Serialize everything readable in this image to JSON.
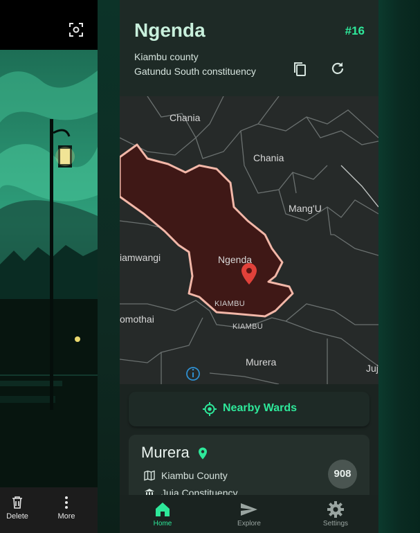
{
  "left_panel": {
    "actions": [
      {
        "label": "Delete",
        "icon": "trash-icon"
      },
      {
        "label": "More",
        "icon": "more-vertical-icon"
      }
    ]
  },
  "header": {
    "title": "Ngenda",
    "ward_number": "#16",
    "county": "Kiambu county",
    "constituency": "Gatundu South constituency"
  },
  "map": {
    "labels": [
      {
        "text": "Chania",
        "kind": "place"
      },
      {
        "text": "Chania",
        "kind": "place"
      },
      {
        "text": "Mang'U",
        "kind": "place"
      },
      {
        "text": "iamwangi",
        "kind": "place"
      },
      {
        "text": "Ngenda",
        "kind": "place"
      },
      {
        "text": "KIAMBU",
        "kind": "county"
      },
      {
        "text": "KIAMBU",
        "kind": "county"
      },
      {
        "text": "omothai",
        "kind": "place"
      },
      {
        "text": "Murera",
        "kind": "place"
      },
      {
        "text": "Juj",
        "kind": "place"
      }
    ]
  },
  "nearby": {
    "label": "Nearby Wards"
  },
  "ward_card": {
    "name": "Murera",
    "county": "Kiambu County",
    "constituency": "Juja Constituency",
    "badge": "908"
  },
  "nav": [
    {
      "label": "Home",
      "icon": "home-icon"
    },
    {
      "label": "Explore",
      "icon": "send-icon"
    },
    {
      "label": "Settings",
      "icon": "gear-icon"
    }
  ],
  "colors": {
    "accent": "#2ee89a",
    "ward_fill": "#3f1816",
    "ward_border": "#f2b7a8"
  }
}
